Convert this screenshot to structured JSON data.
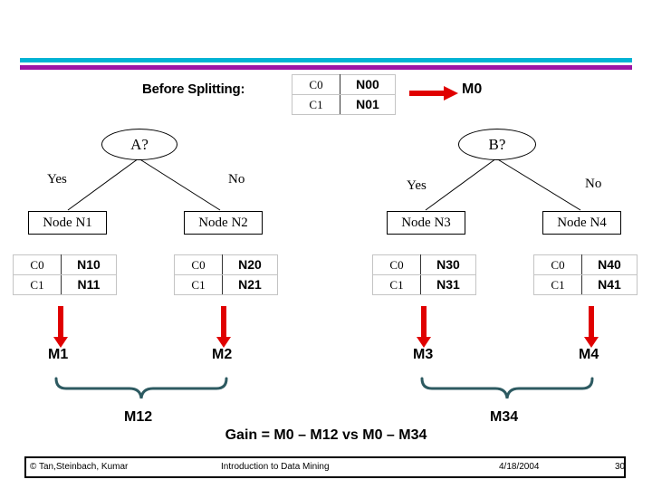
{
  "slide": {
    "before_splitting_label": "Before Splitting:",
    "root_metric_label": "M0",
    "gain_text": "Gain = M0 – M12 vs  M0 – M34",
    "accent_colors": {
      "rule_cyan": "#00b3d4",
      "rule_purple": "#9c14a6",
      "arrow_red": "#e00000",
      "brace_teal": "#2d5a61"
    }
  },
  "root_table": {
    "rows": [
      {
        "label": "C0",
        "value": "N00"
      },
      {
        "label": "C1",
        "value": "N01"
      }
    ]
  },
  "tree": {
    "left": {
      "question": "A?",
      "yes_label": "Yes",
      "no_label": "No",
      "child_yes": "Node N1",
      "child_no": "Node N2"
    },
    "right": {
      "question": "B?",
      "yes_label": "Yes",
      "no_label": "No",
      "child_yes": "Node N3",
      "child_no": "Node N4"
    }
  },
  "leaf_tables": [
    {
      "id": "n1",
      "rows": [
        {
          "label": "C0",
          "value": "N10"
        },
        {
          "label": "C1",
          "value": "N11"
        }
      ]
    },
    {
      "id": "n2",
      "rows": [
        {
          "label": "C0",
          "value": "N20"
        },
        {
          "label": "C1",
          "value": "N21"
        }
      ]
    },
    {
      "id": "n3",
      "rows": [
        {
          "label": "C0",
          "value": "N30"
        },
        {
          "label": "C1",
          "value": "N31"
        }
      ]
    },
    {
      "id": "n4",
      "rows": [
        {
          "label": "C0",
          "value": "N40"
        },
        {
          "label": "C1",
          "value": "N41"
        }
      ]
    }
  ],
  "metrics": {
    "m1": "M1",
    "m2": "M2",
    "m3": "M3",
    "m4": "M4",
    "m12": "M12",
    "m34": "M34"
  },
  "footer": {
    "copyright": "© Tan,Steinbach, Kumar",
    "title": "Introduction to Data Mining",
    "date": "4/18/2004",
    "page": "30"
  }
}
